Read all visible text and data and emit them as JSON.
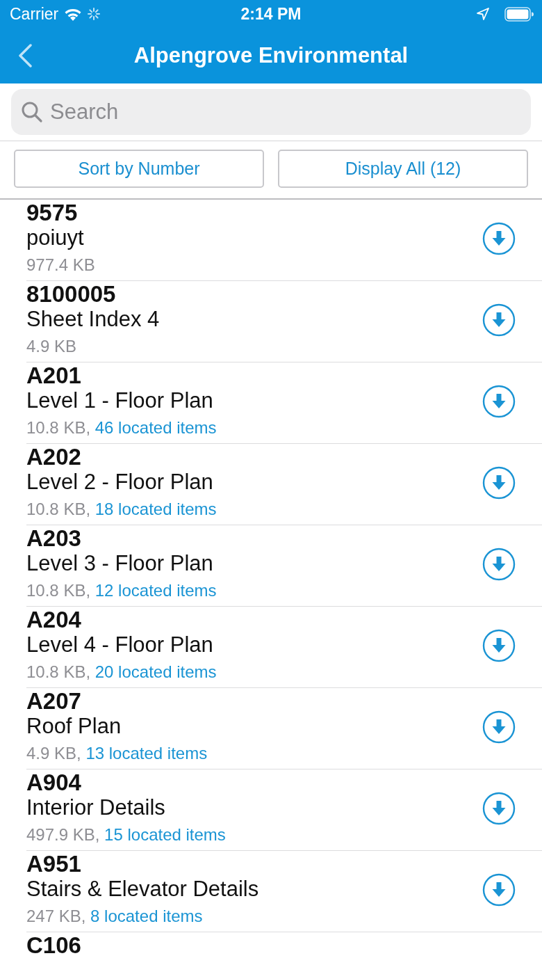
{
  "status_bar": {
    "carrier": "Carrier",
    "time": "2:14 PM"
  },
  "nav_bar": {
    "title": "Alpengrove Environmental"
  },
  "search": {
    "placeholder": "Search"
  },
  "buttons": [
    "Sort by Number",
    "Display All (12)"
  ],
  "rows": [
    {
      "number": "9575",
      "title": "poiuyt",
      "size": "977.4 KB"
    },
    {
      "number": "8100005",
      "title": "Sheet Index 4",
      "size": "4.9 KB"
    },
    {
      "number": "A201",
      "title": "Level 1 - Floor Plan",
      "size": "10.8 KB,",
      "located": "46 located items"
    },
    {
      "number": "A202",
      "title": "Level 2 - Floor Plan",
      "size": "10.8 KB,",
      "located": "18 located items"
    },
    {
      "number": "A203",
      "title": "Level 3 - Floor Plan",
      "size": "10.8 KB,",
      "located": "12 located items"
    },
    {
      "number": "A204",
      "title": "Level 4 - Floor Plan",
      "size": "10.8 KB,",
      "located": "20 located items"
    },
    {
      "number": "A207",
      "title": "Roof Plan",
      "size": "4.9 KB,",
      "located": "13 located items"
    },
    {
      "number": "A904",
      "title": "Interior Details",
      "size": "497.9 KB,",
      "located": "15 located items"
    },
    {
      "number": "A951",
      "title": "Stairs & Elevator Details",
      "size": "247 KB,",
      "located": "8 located items"
    }
  ],
  "cut_off_row": {
    "number": "C106"
  }
}
